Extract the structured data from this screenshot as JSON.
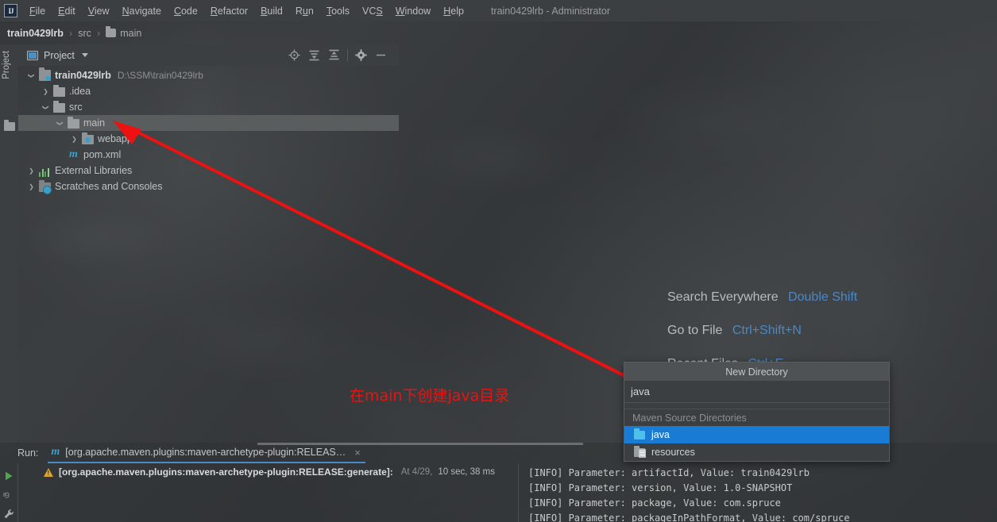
{
  "window": {
    "title": "train0429lrb - Administrator",
    "logo_text": "IJ"
  },
  "menubar": {
    "items": [
      {
        "label": "File",
        "mnemonic": "F"
      },
      {
        "label": "Edit",
        "mnemonic": "E"
      },
      {
        "label": "View",
        "mnemonic": "V"
      },
      {
        "label": "Navigate",
        "mnemonic": "N"
      },
      {
        "label": "Code",
        "mnemonic": "C"
      },
      {
        "label": "Refactor",
        "mnemonic": "R"
      },
      {
        "label": "Build",
        "mnemonic": "B"
      },
      {
        "label": "Run",
        "mnemonic": "u"
      },
      {
        "label": "Tools",
        "mnemonic": "T"
      },
      {
        "label": "VCS",
        "mnemonic": "S"
      },
      {
        "label": "Window",
        "mnemonic": "W"
      },
      {
        "label": "Help",
        "mnemonic": "H"
      }
    ]
  },
  "breadcrumb": {
    "project": "train0429lrb",
    "src": "src",
    "main": "main",
    "separator": "›"
  },
  "toolstrip": {
    "project_label": "Project"
  },
  "project_panel": {
    "title": "Project",
    "toolbar": [
      {
        "name": "locate-icon",
        "tooltip": "Select Opened File"
      },
      {
        "name": "expand-all-icon",
        "tooltip": "Expand All"
      },
      {
        "name": "collapse-all-icon",
        "tooltip": "Collapse All"
      },
      {
        "name": "gear-icon",
        "tooltip": "Settings"
      },
      {
        "name": "minimize-icon",
        "tooltip": "Hide"
      }
    ],
    "tree": [
      {
        "label": "train0429lrb",
        "path": "D:\\SSM\\train0429lrb",
        "icon": "module-icon",
        "state": "expanded",
        "indent": 0,
        "bold": true
      },
      {
        "label": ".idea",
        "path": "",
        "icon": "folder-icon",
        "state": "collapsed",
        "indent": 1,
        "bold": false
      },
      {
        "label": "src",
        "path": "",
        "icon": "folder-icon",
        "state": "expanded",
        "indent": 1,
        "bold": false
      },
      {
        "label": "main",
        "path": "",
        "icon": "folder-icon",
        "state": "expanded",
        "indent": 2,
        "bold": false,
        "selected": true
      },
      {
        "label": "webapp",
        "path": "",
        "icon": "webapp-folder-icon",
        "state": "collapsed",
        "indent": 3,
        "bold": false
      },
      {
        "label": "pom.xml",
        "path": "",
        "icon": "maven-file-icon",
        "state": "none",
        "indent": 2,
        "bold": false
      },
      {
        "label": "External Libraries",
        "path": "",
        "icon": "libraries-icon",
        "state": "collapsed",
        "indent": 0,
        "bold": false
      },
      {
        "label": "Scratches and Consoles",
        "path": "",
        "icon": "scratches-icon",
        "state": "collapsed",
        "indent": 0,
        "bold": false
      }
    ]
  },
  "hints": [
    {
      "label": "Search Everywhere",
      "key": "Double Shift"
    },
    {
      "label": "Go to File",
      "key": "Ctrl+Shift+N"
    },
    {
      "label": "Recent Files",
      "key": "Ctrl+E"
    }
  ],
  "annotation": {
    "text": "在main下创建java目录",
    "color": "#ee1111"
  },
  "new_directory_popup": {
    "title": "New Directory",
    "input_value": "java",
    "input_placeholder": "",
    "group_label": "Maven Source Directories",
    "options": [
      {
        "label": "java",
        "icon": "source-folder-icon",
        "selected": true
      },
      {
        "label": "resources",
        "icon": "resources-folder-icon",
        "selected": false
      }
    ],
    "accent": "#1a7bd4"
  },
  "run_window": {
    "run_label": "Run:",
    "tab": {
      "icon": "maven-icon",
      "label": "[org.apache.maven.plugins:maven-archetype-plugin:RELEAS…",
      "close": "×"
    },
    "gutter": [
      {
        "name": "rerun-icon",
        "glyph": "▶"
      },
      {
        "name": "stop-9-icon",
        "glyph": "9"
      },
      {
        "name": "wrench-icon",
        "glyph": "🔧"
      }
    ],
    "tree_node": {
      "goal": "[org.apache.maven.plugins:maven-archetype-plugin:RELEASE:generate]:",
      "at": "At 4/29,",
      "duration": "10 sec, 38 ms"
    },
    "console": [
      "[INFO] Parameter: artifactId, Value: train0429lrb",
      "[INFO] Parameter: version, Value: 1.0-SNAPSHOT",
      "[INFO] Parameter: package, Value: com.spruce",
      "[INFO] Parameter: packageInPathFormat, Value: com/spruce"
    ]
  },
  "colors": {
    "bg": "#3c3f41",
    "selection": "#1a7bd4",
    "link": "#4a88c7",
    "accent_cyan": "#3d9ec9",
    "warn": "#e0a526",
    "annotation_red": "#ee1111"
  }
}
